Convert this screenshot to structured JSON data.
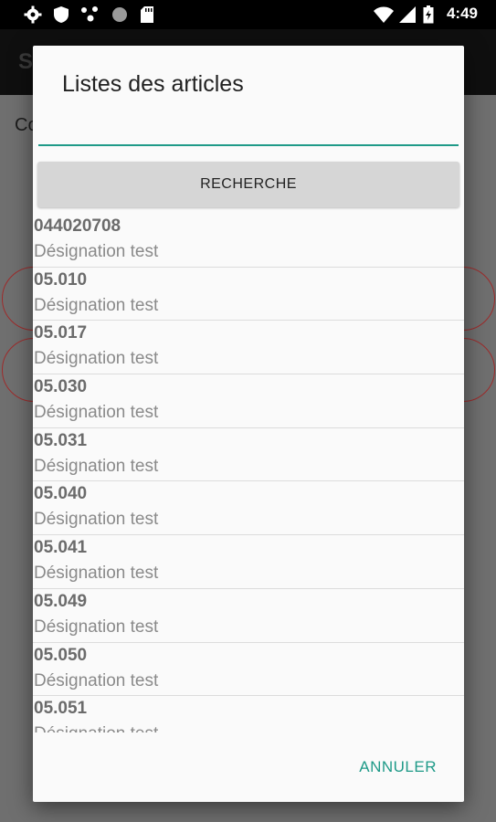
{
  "status_bar": {
    "time": "4:49",
    "icons": [
      "gear-icon",
      "shield-icon",
      "network-dots-icon",
      "circle-icon",
      "sd-card-icon",
      "wifi-icon",
      "signal-icon",
      "battery-icon"
    ]
  },
  "background": {
    "toolbar_title": "S",
    "label": "Co"
  },
  "dialog": {
    "title": "Listes des articles",
    "search_value": "",
    "search_button_label": "RECHERCHE",
    "cancel_label": "ANNULER",
    "accent_color": "#1f9a88",
    "items": [
      {
        "code": "044020708",
        "designation": "Désignation test"
      },
      {
        "code": "05.010",
        "designation": "Désignation test"
      },
      {
        "code": "05.017",
        "designation": "Désignation test"
      },
      {
        "code": "05.030",
        "designation": "Désignation test"
      },
      {
        "code": "05.031",
        "designation": "Désignation test"
      },
      {
        "code": "05.040",
        "designation": "Désignation test"
      },
      {
        "code": "05.041",
        "designation": "Désignation test"
      },
      {
        "code": "05.049",
        "designation": "Désignation test"
      },
      {
        "code": "05.050",
        "designation": "Désignation test"
      },
      {
        "code": "05.051",
        "designation": "Désignation test"
      }
    ]
  }
}
